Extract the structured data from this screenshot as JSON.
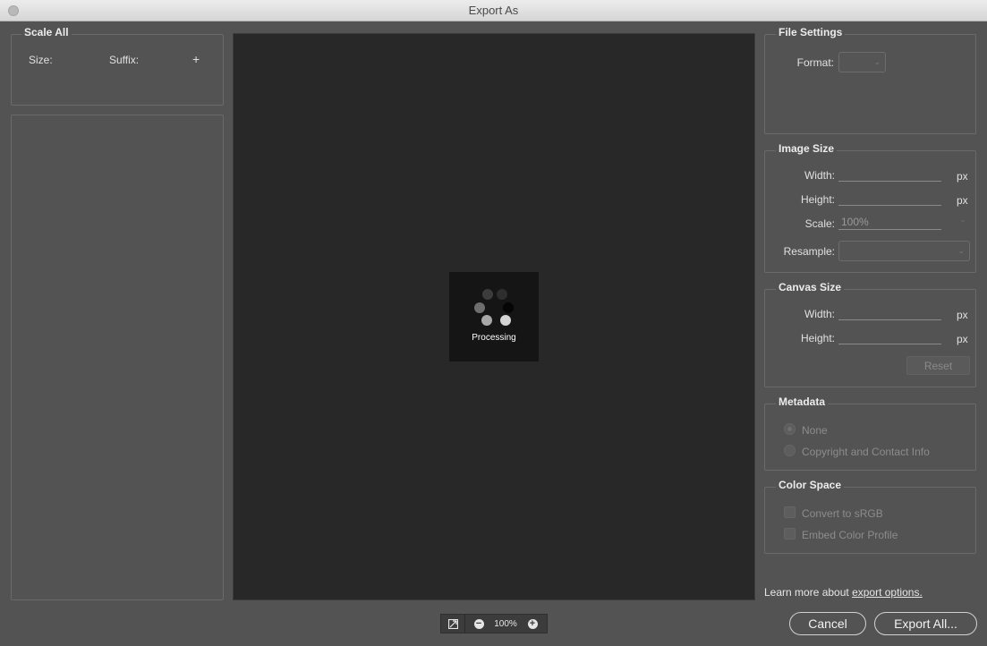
{
  "window": {
    "title": "Export As"
  },
  "scale_all": {
    "title": "Scale All",
    "size_label": "Size:",
    "suffix_label": "Suffix:",
    "add_label": "+"
  },
  "preview": {
    "status": "Processing"
  },
  "zoom": {
    "level": "100%",
    "minus": "−",
    "plus": "+"
  },
  "file_settings": {
    "title": "File Settings",
    "format_label": "Format:"
  },
  "image_size": {
    "title": "Image Size",
    "width_label": "Width:",
    "height_label": "Height:",
    "scale_label": "Scale:",
    "scale_value": "100%",
    "resample_label": "Resample:",
    "unit": "px"
  },
  "canvas_size": {
    "title": "Canvas Size",
    "width_label": "Width:",
    "height_label": "Height:",
    "unit": "px",
    "reset_label": "Reset"
  },
  "metadata": {
    "title": "Metadata",
    "options": [
      "None",
      "Copyright and Contact Info"
    ],
    "selected": "None"
  },
  "color_space": {
    "title": "Color Space",
    "options": [
      "Convert to sRGB",
      "Embed Color Profile"
    ]
  },
  "footer": {
    "learn_prefix": "Learn more about ",
    "learn_link": "export options.",
    "cancel_label": "Cancel",
    "export_label": "Export All..."
  }
}
